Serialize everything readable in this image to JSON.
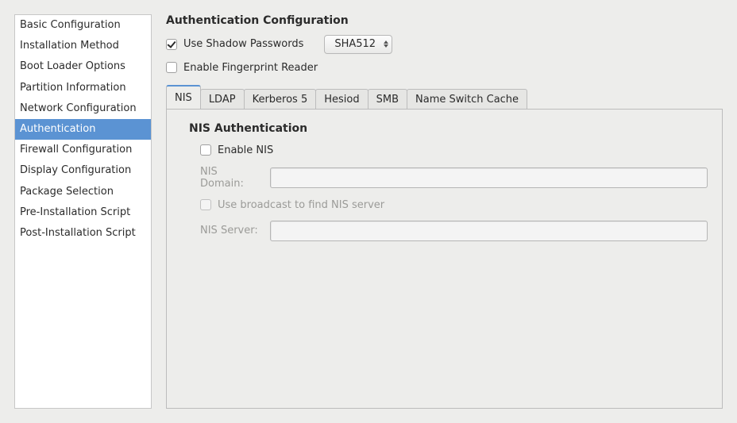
{
  "sidebar": {
    "items": [
      {
        "label": "Basic Configuration",
        "selected": false
      },
      {
        "label": "Installation Method",
        "selected": false
      },
      {
        "label": "Boot Loader Options",
        "selected": false
      },
      {
        "label": "Partition Information",
        "selected": false
      },
      {
        "label": "Network Configuration",
        "selected": false
      },
      {
        "label": "Authentication",
        "selected": true
      },
      {
        "label": "Firewall Configuration",
        "selected": false
      },
      {
        "label": "Display Configuration",
        "selected": false
      },
      {
        "label": "Package Selection",
        "selected": false
      },
      {
        "label": "Pre-Installation Script",
        "selected": false
      },
      {
        "label": "Post-Installation Script",
        "selected": false
      }
    ]
  },
  "main": {
    "title": "Authentication Configuration",
    "shadow": {
      "label": "Use Shadow Passwords",
      "checked": true,
      "hash_selected": "SHA512"
    },
    "fingerprint": {
      "label": "Enable Fingerprint Reader",
      "checked": false
    },
    "tabs": [
      {
        "key": "nis",
        "label": "NIS",
        "active": true
      },
      {
        "key": "ldap",
        "label": "LDAP",
        "active": false
      },
      {
        "key": "kerberos",
        "label": "Kerberos 5",
        "active": false
      },
      {
        "key": "hesiod",
        "label": "Hesiod",
        "active": false
      },
      {
        "key": "smb",
        "label": "SMB",
        "active": false
      },
      {
        "key": "nscd",
        "label": "Name Switch Cache",
        "active": false
      }
    ],
    "nis": {
      "section_title": "NIS Authentication",
      "enable_label": "Enable NIS",
      "enable_checked": false,
      "domain_label": "NIS Domain:",
      "domain_value": "",
      "broadcast_label": "Use broadcast to find NIS server",
      "broadcast_checked": false,
      "server_label": "NIS Server:",
      "server_value": ""
    }
  }
}
